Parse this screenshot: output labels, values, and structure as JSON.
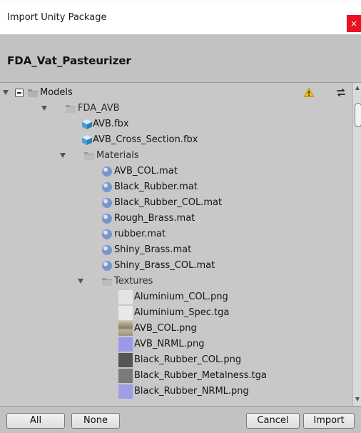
{
  "window": {
    "title": "Import Unity Package",
    "close_glyph": "×"
  },
  "package": {
    "name": "FDA_Vat_Pasteurizer"
  },
  "tree": {
    "root": {
      "label": "Models",
      "warning_icon": "warning-icon",
      "sync_icon": "refresh-icon"
    },
    "items": [
      {
        "label": "FDA_AVB",
        "icon": "folder-icon"
      },
      {
        "label": "AVB.fbx",
        "icon": "model-icon"
      },
      {
        "label": "AVB_Cross_Section.fbx",
        "icon": "model-icon"
      },
      {
        "label": "Materials",
        "icon": "folder-icon"
      },
      {
        "label": "AVB_COL.mat",
        "icon": "material-sphere-icon"
      },
      {
        "label": "Black_Rubber.mat",
        "icon": "material-sphere-icon"
      },
      {
        "label": "Black_Rubber_COL.mat",
        "icon": "material-sphere-icon"
      },
      {
        "label": "Rough_Brass.mat",
        "icon": "material-sphere-icon"
      },
      {
        "label": "rubber.mat",
        "icon": "material-sphere-icon"
      },
      {
        "label": "Shiny_Brass.mat",
        "icon": "material-sphere-icon"
      },
      {
        "label": "Shiny_Brass_COL.mat",
        "icon": "material-sphere-icon"
      },
      {
        "label": "Textures",
        "icon": "folder-icon"
      },
      {
        "label": "Aluminium_COL.png",
        "icon": "texture-thumbnail",
        "color": "#e4e4e4"
      },
      {
        "label": "Aluminium_Spec.tga",
        "icon": "texture-thumbnail",
        "color": "#e8e8e8"
      },
      {
        "label": "AVB_COL.png",
        "icon": "texture-thumbnail",
        "color": "#a99a80"
      },
      {
        "label": "AVB_NRML.png",
        "icon": "texture-thumbnail",
        "color": "#9d98e8"
      },
      {
        "label": "Black_Rubber_COL.png",
        "icon": "texture-thumbnail",
        "color": "#555555"
      },
      {
        "label": "Black_Rubber_Metalness.tga",
        "icon": "texture-thumbnail",
        "color": "#7a7a7a"
      },
      {
        "label": "Black_Rubber_NRML.png",
        "icon": "texture-thumbnail",
        "color": "#a09ce8"
      }
    ]
  },
  "footer": {
    "all_label": "All",
    "none_label": "None",
    "cancel_label": "Cancel",
    "import_label": "Import"
  },
  "colors": {
    "close": "#e81123",
    "warning": "#f2c200",
    "panel": "#c2c2c2",
    "tree_bg": "#c8c8c8"
  }
}
